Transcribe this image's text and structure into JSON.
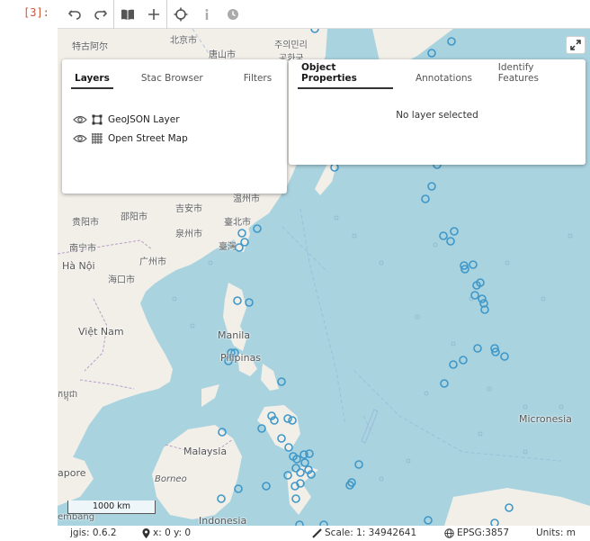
{
  "cell": {
    "prompt": "[3]:"
  },
  "toolbar": {
    "buttons": [
      {
        "name": "undo-icon"
      },
      {
        "name": "redo-icon"
      },
      {
        "name": "book-icon"
      },
      {
        "name": "plus-icon"
      },
      {
        "name": "crosshair-icon"
      },
      {
        "name": "info-icon"
      },
      {
        "name": "history-icon"
      }
    ]
  },
  "left_panel": {
    "tabs": [
      {
        "label": "Layers",
        "active": true
      },
      {
        "label": "Stac Browser",
        "active": false
      },
      {
        "label": "Filters",
        "active": false
      }
    ],
    "layers": [
      {
        "label": "GeoJSON Layer",
        "icon": "vector-icon"
      },
      {
        "label": "Open Street Map",
        "icon": "raster-grid-icon"
      }
    ]
  },
  "right_panel": {
    "tabs": [
      {
        "label": "Object Properties",
        "active": true
      },
      {
        "label": "Annotations",
        "active": false
      },
      {
        "label": "Identify Features",
        "active": false
      }
    ],
    "empty_message": "No layer selected"
  },
  "map": {
    "labels": {
      "tegu": "特古阿尔",
      "beijing": "北京市",
      "pyongyang": "주의민리",
      "tangshan": "唐山市",
      "gonghua": "공화국",
      "wenzhou": "温州市",
      "guiyang": "贵阳市",
      "shaoyang": "邵阳市",
      "jian": "吉安市",
      "taipei": "臺北市",
      "quanzhou": "泉州市",
      "taiwan": "臺灣",
      "nanning": "南宁市",
      "guangzhou": "广州市",
      "hanoi": "Hà Nội",
      "haikou": "海口市",
      "vietnam": "Việt Nam",
      "manila": "Manila",
      "philippines": "Pilipinas",
      "khmer": "កម្ពុជា",
      "malaysia": "Malaysia",
      "singapore": "apore",
      "borneo": "Borneo",
      "micronesia": "Micronesia",
      "indonesia": "Indonesia",
      "lembang": "embang"
    },
    "scale_label": "1000 km"
  },
  "colors": {
    "sea": "#a9d3df",
    "land": "#f2efe9",
    "marker": "#3f97c8",
    "prompt": "#c9573d"
  },
  "status": {
    "version": "jgis: 0.6.2",
    "coords": "x: 0 y: 0",
    "scale": "Scale: 1: 34942641",
    "crs": "EPSG:3857",
    "units": "Units: m"
  }
}
